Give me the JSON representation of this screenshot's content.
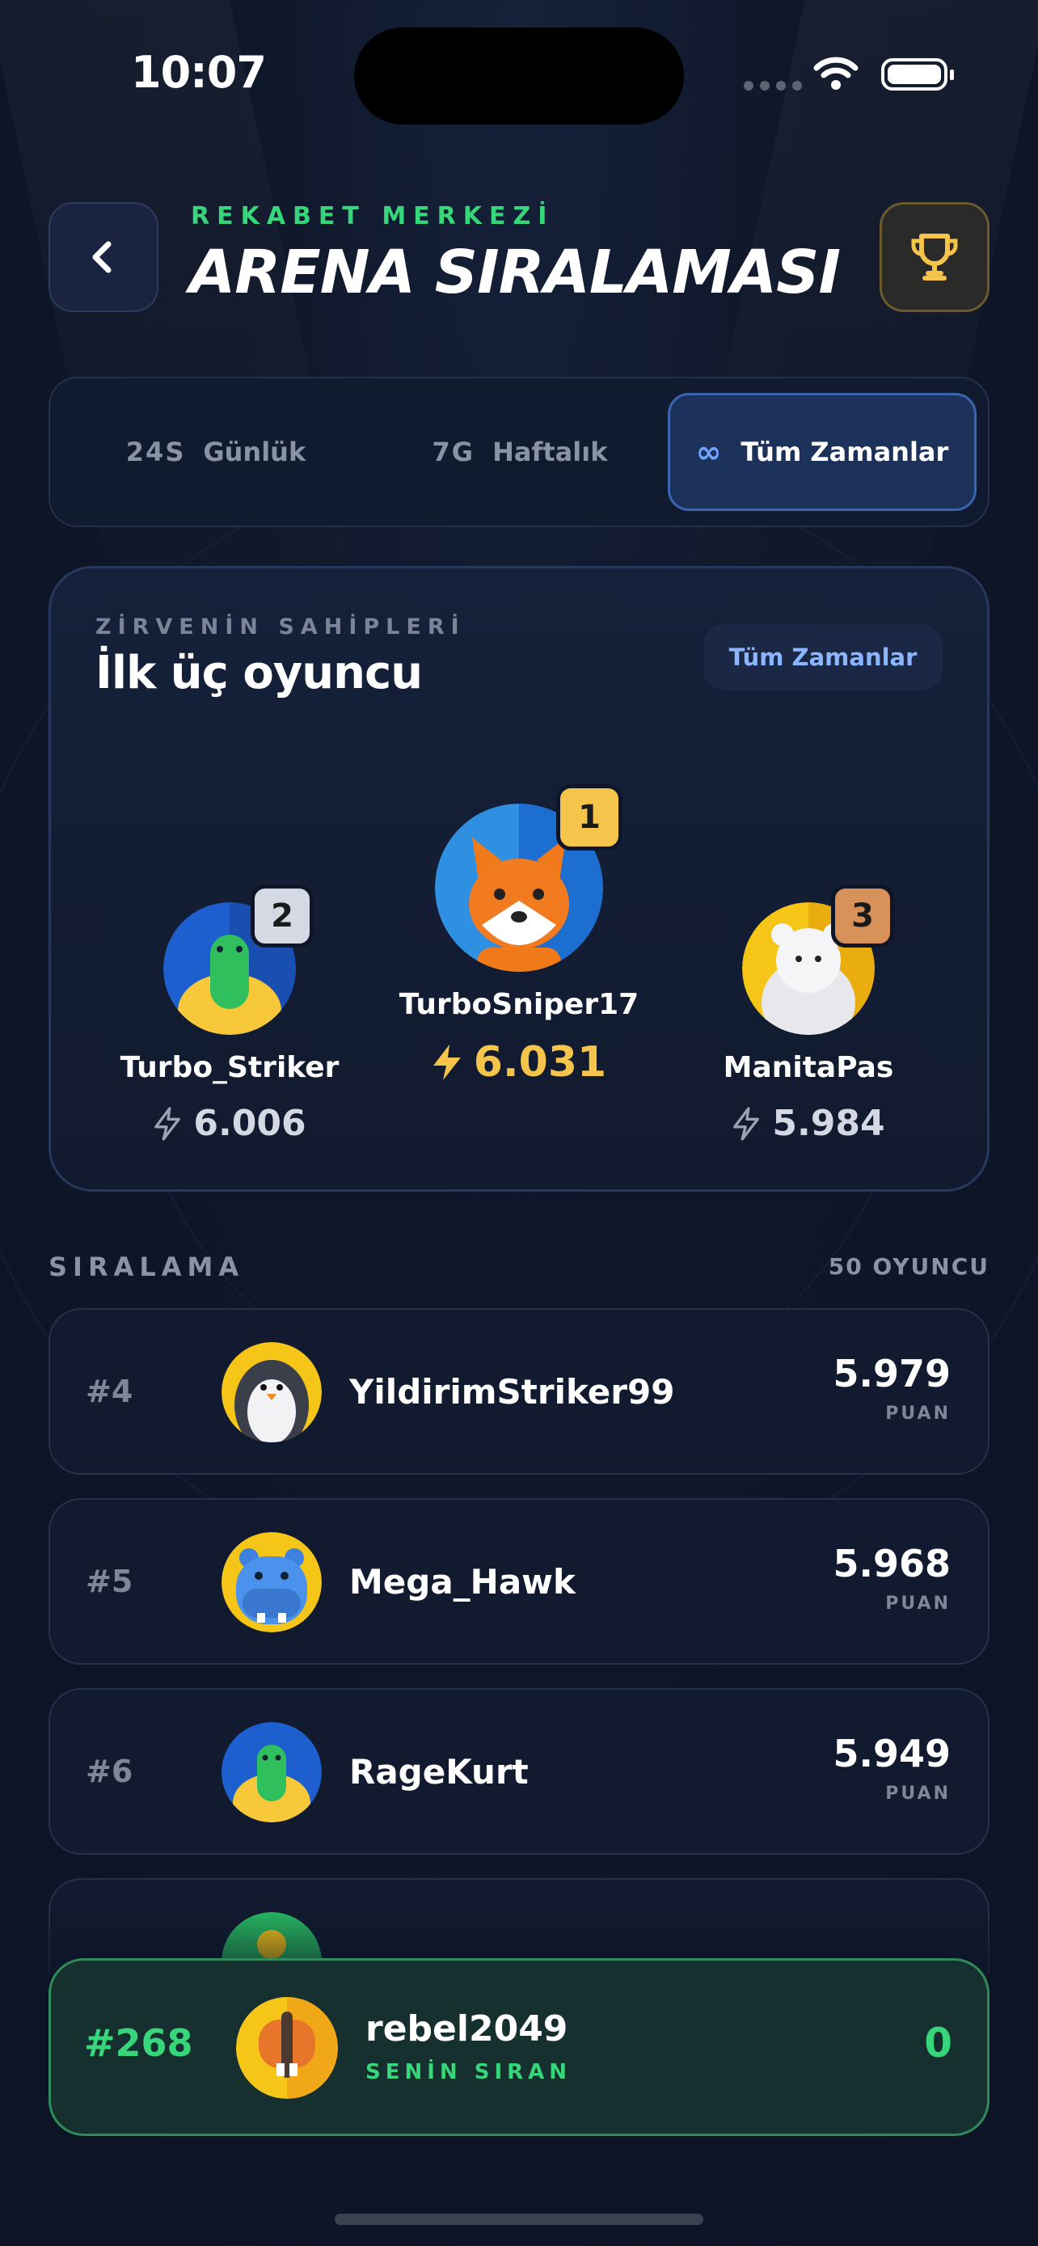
{
  "status": {
    "time": "10:07"
  },
  "header": {
    "kicker": "REKABET MERKEZİ",
    "title": "ARENA SIRALAMASI",
    "back_icon": "chevron-left-icon",
    "trophy_icon": "trophy-icon"
  },
  "tabs": [
    {
      "prefix": "24S",
      "label": "Günlük",
      "active": false
    },
    {
      "prefix": "7G",
      "label": "Haftalık",
      "active": false
    },
    {
      "prefix": "∞",
      "label": "Tüm Zamanlar",
      "active": true
    }
  ],
  "podium": {
    "kicker": "ZİRVENİN SAHİPLERİ",
    "title": "İlk üç oyuncu",
    "chip": "Tüm Zamanlar",
    "first": {
      "place": "1",
      "name": "TurboSniper17",
      "score": "6.031"
    },
    "second": {
      "place": "2",
      "name": "Turbo_Striker",
      "score": "6.006"
    },
    "third": {
      "place": "3",
      "name": "ManitaPas",
      "score": "5.984"
    }
  },
  "ranking": {
    "heading": "SIRALAMA",
    "count": "50 OYUNCU",
    "points_label": "PUAN",
    "rows": [
      {
        "rank": "#4",
        "name": "YildirimStriker99",
        "score": "5.979",
        "avatar": "penguin"
      },
      {
        "rank": "#5",
        "name": "Mega_Hawk",
        "score": "5.968",
        "avatar": "hippo"
      },
      {
        "rank": "#6",
        "name": "RageKurt",
        "score": "5.949",
        "avatar": "turtle"
      }
    ]
  },
  "me": {
    "rank": "#268",
    "name": "rebel2049",
    "subtitle": "SENİN SIRAN",
    "score": "0"
  },
  "colors": {
    "accent_green": "#37d67a",
    "gold": "#f4c54a",
    "blue": "#6ea4ff"
  }
}
